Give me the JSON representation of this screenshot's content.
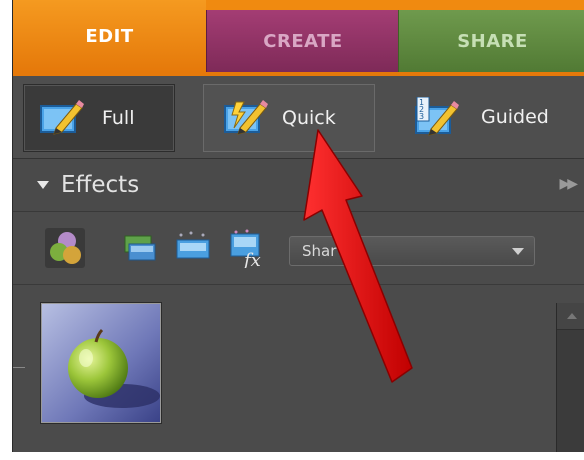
{
  "tabs": [
    {
      "label": "EDIT",
      "active": true,
      "color": "#f08a10"
    },
    {
      "label": "CREATE",
      "active": false,
      "color": "#8e3164"
    },
    {
      "label": "SHARE",
      "active": false,
      "color": "#5f8a40"
    }
  ],
  "modes": {
    "full": {
      "label": "Full",
      "icon": "photo-pencil-icon",
      "selected": true
    },
    "quick": {
      "label": "Quick",
      "icon": "quick-fix-icon",
      "selected": false
    },
    "guided": {
      "label": "Guided",
      "icon": "guided-steps-icon",
      "selected": false
    }
  },
  "effects_panel": {
    "title": "Effects",
    "more_icon": "panel-menu-icon",
    "type_icons": [
      "filters-icon",
      "layer-styles-icon",
      "photo-effects-icon",
      "fx-icon"
    ],
    "dropdown_value": "Shar  n",
    "thumbnails": [
      {
        "icon": "green-apple-thumbnail"
      }
    ]
  },
  "annotation": {
    "arrow_color": "#e01010",
    "points_to": "quick-mode-button"
  }
}
